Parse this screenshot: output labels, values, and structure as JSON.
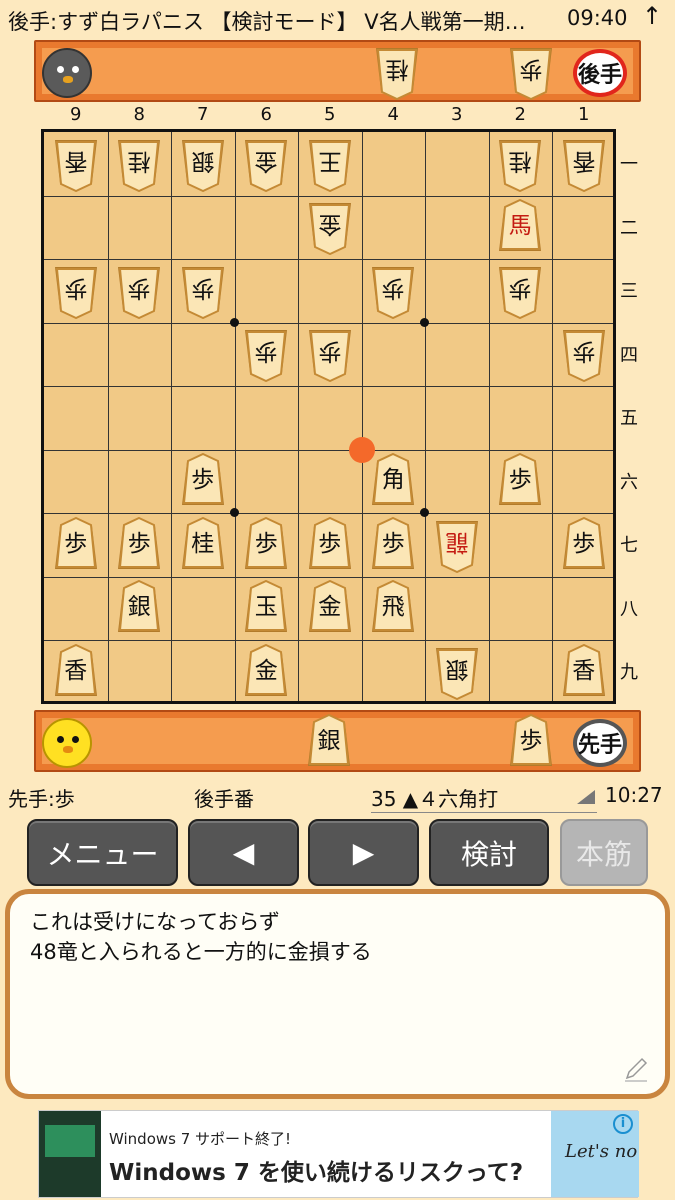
{
  "status_bar": {
    "title": "後手:すず白ラパニス 【検討モード】 V名人戦第一期…",
    "time": "09:40",
    "arrow": "↑"
  },
  "gote_stand": {
    "badge": "後手",
    "hand_pieces": [
      {
        "name": "kei",
        "label": "桂"
      },
      {
        "name": "fu",
        "label": "歩"
      }
    ]
  },
  "sente_stand": {
    "badge": "先手",
    "hand_pieces": [
      {
        "name": "gin",
        "label": "銀"
      },
      {
        "name": "fu",
        "label": "歩"
      }
    ]
  },
  "files": [
    "9",
    "8",
    "7",
    "6",
    "5",
    "4",
    "3",
    "2",
    "1"
  ],
  "ranks": [
    "一",
    "二",
    "三",
    "四",
    "五",
    "六",
    "七",
    "八",
    "九"
  ],
  "board_pieces": [
    {
      "file": 9,
      "rank": 1,
      "label": "香",
      "owner": "gote"
    },
    {
      "file": 8,
      "rank": 1,
      "label": "桂",
      "owner": "gote"
    },
    {
      "file": 7,
      "rank": 1,
      "label": "銀",
      "owner": "gote"
    },
    {
      "file": 6,
      "rank": 1,
      "label": "金",
      "owner": "gote"
    },
    {
      "file": 5,
      "rank": 1,
      "label": "王",
      "owner": "gote"
    },
    {
      "file": 2,
      "rank": 1,
      "label": "桂",
      "owner": "gote"
    },
    {
      "file": 1,
      "rank": 1,
      "label": "香",
      "owner": "gote"
    },
    {
      "file": 5,
      "rank": 2,
      "label": "金",
      "owner": "gote"
    },
    {
      "file": 2,
      "rank": 2,
      "label": "馬",
      "owner": "sente",
      "promoted": true
    },
    {
      "file": 9,
      "rank": 3,
      "label": "歩",
      "owner": "gote"
    },
    {
      "file": 8,
      "rank": 3,
      "label": "歩",
      "owner": "gote"
    },
    {
      "file": 7,
      "rank": 3,
      "label": "歩",
      "owner": "gote"
    },
    {
      "file": 4,
      "rank": 3,
      "label": "歩",
      "owner": "gote"
    },
    {
      "file": 2,
      "rank": 3,
      "label": "歩",
      "owner": "gote"
    },
    {
      "file": 6,
      "rank": 4,
      "label": "歩",
      "owner": "gote"
    },
    {
      "file": 5,
      "rank": 4,
      "label": "歩",
      "owner": "gote"
    },
    {
      "file": 1,
      "rank": 4,
      "label": "歩",
      "owner": "gote"
    },
    {
      "file": 7,
      "rank": 6,
      "label": "歩",
      "owner": "sente"
    },
    {
      "file": 4,
      "rank": 6,
      "label": "角",
      "owner": "sente"
    },
    {
      "file": 2,
      "rank": 6,
      "label": "歩",
      "owner": "sente"
    },
    {
      "file": 9,
      "rank": 7,
      "label": "歩",
      "owner": "sente"
    },
    {
      "file": 8,
      "rank": 7,
      "label": "歩",
      "owner": "sente"
    },
    {
      "file": 7,
      "rank": 7,
      "label": "桂",
      "owner": "sente"
    },
    {
      "file": 6,
      "rank": 7,
      "label": "歩",
      "owner": "sente"
    },
    {
      "file": 5,
      "rank": 7,
      "label": "歩",
      "owner": "sente"
    },
    {
      "file": 4,
      "rank": 7,
      "label": "歩",
      "owner": "sente"
    },
    {
      "file": 3,
      "rank": 7,
      "label": "龍",
      "owner": "gote",
      "promoted": true
    },
    {
      "file": 1,
      "rank": 7,
      "label": "歩",
      "owner": "sente"
    },
    {
      "file": 8,
      "rank": 8,
      "label": "銀",
      "owner": "sente"
    },
    {
      "file": 6,
      "rank": 8,
      "label": "玉",
      "owner": "sente"
    },
    {
      "file": 5,
      "rank": 8,
      "label": "金",
      "owner": "sente"
    },
    {
      "file": 4,
      "rank": 8,
      "label": "飛",
      "owner": "sente"
    },
    {
      "file": 9,
      "rank": 9,
      "label": "香",
      "owner": "sente"
    },
    {
      "file": 6,
      "rank": 9,
      "label": "金",
      "owner": "sente"
    },
    {
      "file": 3,
      "rank": 9,
      "label": "銀",
      "owner": "gote"
    },
    {
      "file": 1,
      "rank": 9,
      "label": "香",
      "owner": "sente"
    }
  ],
  "last_move": {
    "file": 4,
    "rank": 6
  },
  "info": {
    "hand": "先手:歩",
    "turn": "後手番",
    "move": "35 ▲４六角打",
    "elapsed": "10:27"
  },
  "buttons": {
    "menu": "メニュー",
    "back": "◀",
    "forward": "▶",
    "analyze": "検討",
    "main_line": "本筋"
  },
  "comment": {
    "line1": "これは受けになっておらず",
    "line2": "48竜と入られると一方的に金損する"
  },
  "ad": {
    "small": "Windows 7 サポート終了!",
    "big": "Windows 7 を使い続けるリスクって?",
    "logo": "Let's no",
    "info": "i"
  }
}
